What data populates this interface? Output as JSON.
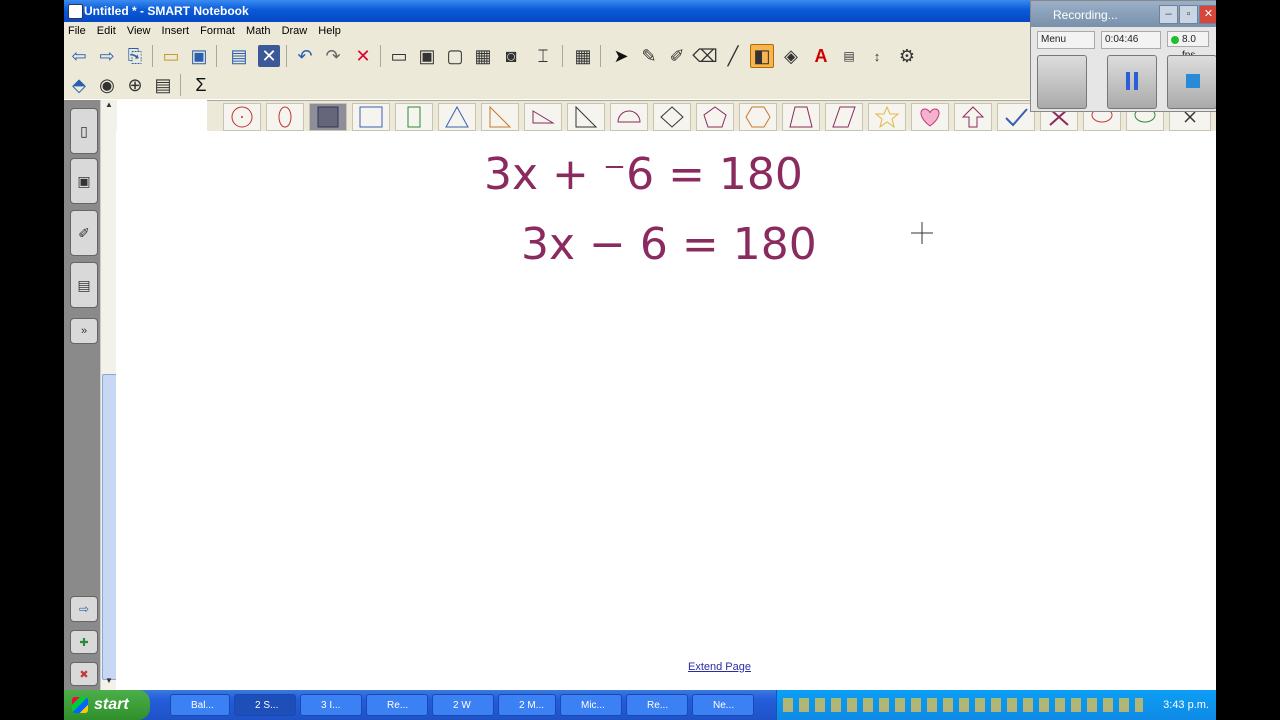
{
  "app": {
    "title": "Untitled * - SMART Notebook"
  },
  "menu": [
    "File",
    "Edit",
    "View",
    "Insert",
    "Format",
    "Math",
    "Draw",
    "Help"
  ],
  "recorder": {
    "title": "Recording...",
    "mode": "Menu",
    "elapsed": "0:04:46",
    "fps": "8.0 fps"
  },
  "canvas": {
    "line1": "3x + ⁻6 = 180",
    "line2": "3x − 6 = 180",
    "extend_link": "Extend Page"
  },
  "taskbar": {
    "start": "start",
    "tasks": [
      "Bal...",
      "2 S...",
      "3 I...",
      "Re...",
      "2 W",
      "2 M...",
      "Mic...",
      "Re...",
      "Ne..."
    ],
    "clock": "3:43 p.m."
  },
  "colors": {
    "ink": "#8a2a5e",
    "titlebar": "#0a5ad8",
    "accent": "#f7b44f"
  }
}
